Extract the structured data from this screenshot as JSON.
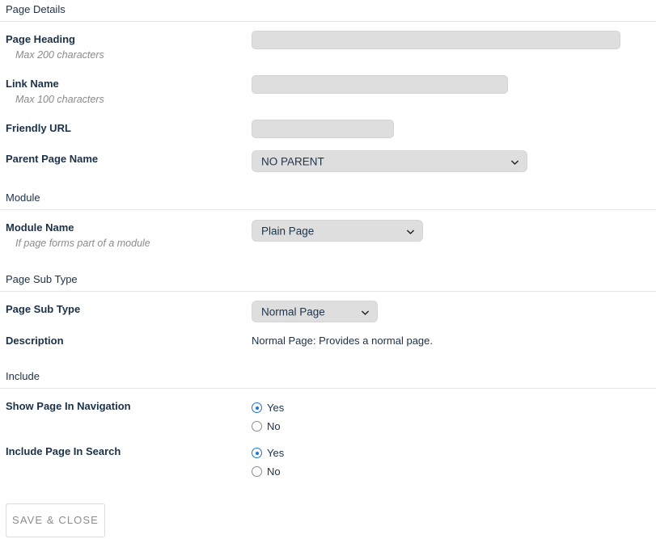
{
  "sections": {
    "page_details": {
      "title": "Page Details"
    },
    "module": {
      "title": "Module"
    },
    "page_sub_type": {
      "title": "Page Sub Type"
    },
    "include": {
      "title": "Include"
    }
  },
  "fields": {
    "page_heading": {
      "label": "Page Heading",
      "hint": "Max 200 characters",
      "value": "",
      "placeholder": ""
    },
    "link_name": {
      "label": "Link Name",
      "hint": "Max 100 characters",
      "value": "",
      "placeholder": ""
    },
    "friendly_url": {
      "label": "Friendly URL",
      "value": "",
      "placeholder": ""
    },
    "parent_page_name": {
      "label": "Parent Page Name",
      "selected": "NO PARENT"
    },
    "module_name": {
      "label": "Module Name",
      "hint": "If page forms part of a module",
      "selected": "Plain Page"
    },
    "page_sub_type": {
      "label": "Page Sub Type",
      "selected": "Normal Page"
    },
    "description": {
      "label": "Description",
      "value": "Normal Page: Provides a normal page."
    },
    "show_page_in_navigation": {
      "label": "Show Page In Navigation",
      "options": [
        {
          "label": "Yes",
          "checked": true
        },
        {
          "label": "No",
          "checked": false
        }
      ]
    },
    "include_page_in_search": {
      "label": "Include Page In Search",
      "options": [
        {
          "label": "Yes",
          "checked": true
        },
        {
          "label": "No",
          "checked": false
        }
      ]
    }
  },
  "actions": {
    "save_and_close": "SAVE & CLOSE"
  },
  "icons": {
    "chevron_down": "chevron-down-icon"
  },
  "colors": {
    "label_text": "#1b3148",
    "hint_text": "#8b8b8b",
    "input_fill": "#dedede",
    "divider": "#e4e4e4",
    "radio_accent": "#1a73d8",
    "button_text": "#8d8d8d",
    "button_border": "#dcdcdc"
  }
}
